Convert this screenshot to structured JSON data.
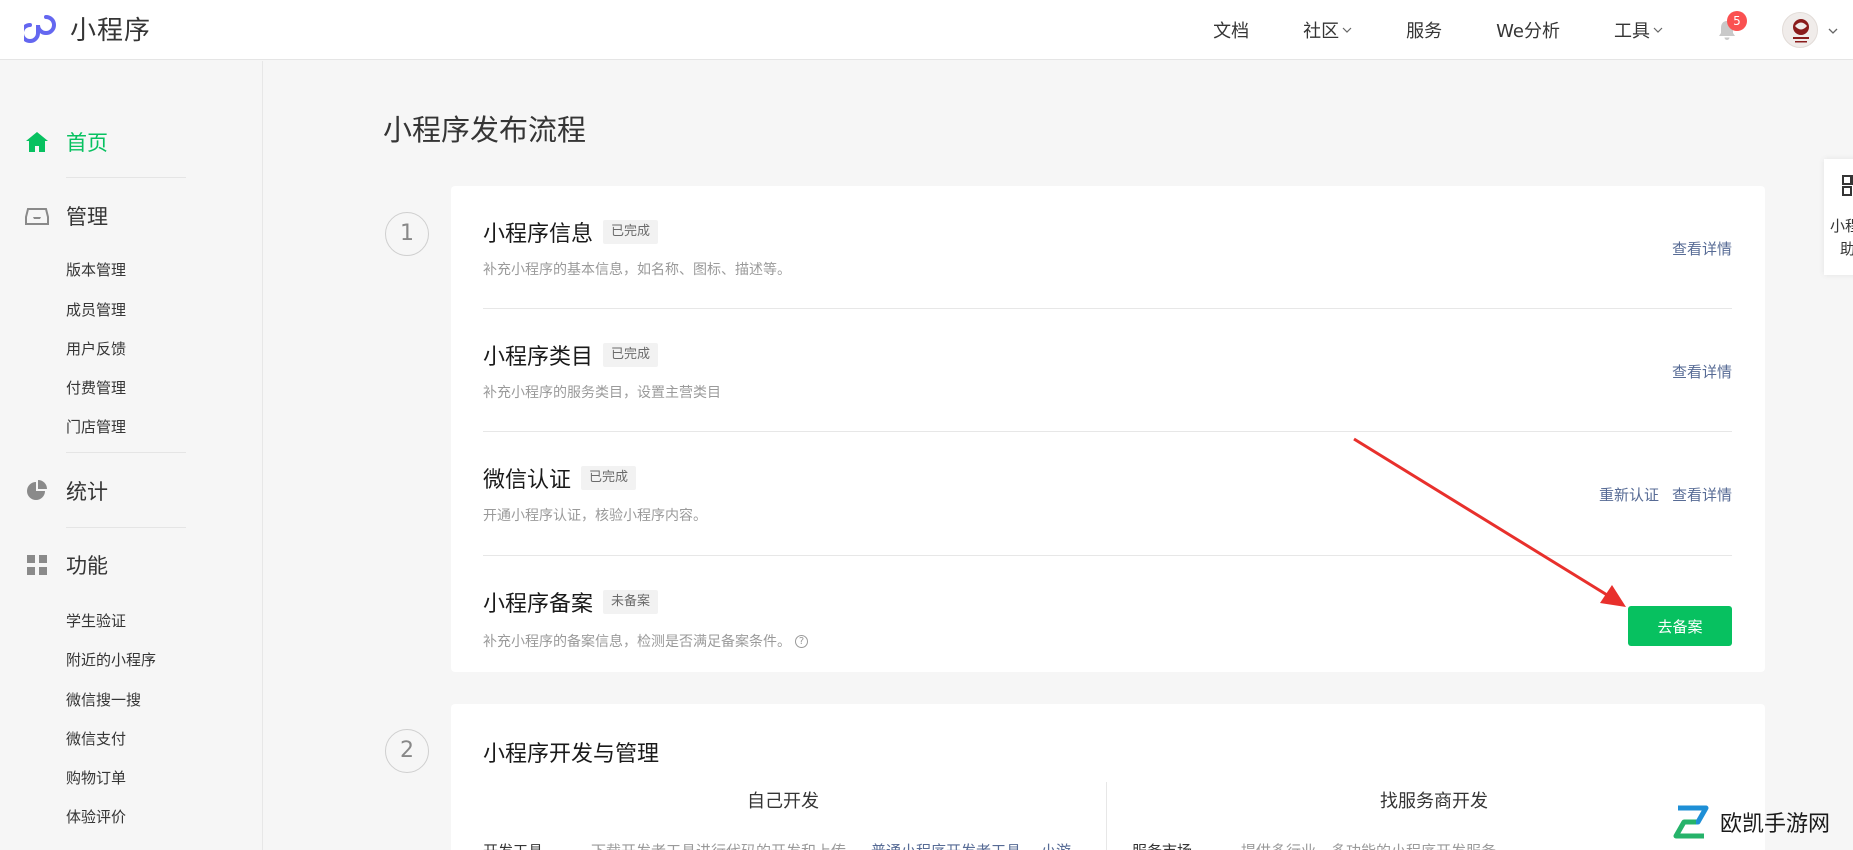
{
  "header": {
    "logo_text": "小程序",
    "nav": [
      {
        "label": "文档",
        "has_dropdown": false
      },
      {
        "label": "社区",
        "has_dropdown": true
      },
      {
        "label": "服务",
        "has_dropdown": false
      },
      {
        "label": "We分析",
        "has_dropdown": false
      },
      {
        "label": "工具",
        "has_dropdown": true
      }
    ],
    "notification_count": "5"
  },
  "sidebar": {
    "home": "首页",
    "manage": "管理",
    "manage_items": [
      "版本管理",
      "成员管理",
      "用户反馈",
      "付费管理",
      "门店管理"
    ],
    "stats": "统计",
    "features": "功能",
    "feature_items": [
      "学生验证",
      "附近的小程序",
      "微信搜一搜",
      "微信支付",
      "购物订单",
      "体验评价"
    ]
  },
  "main": {
    "page_title": "小程序发布流程",
    "step1": {
      "number": "1",
      "rows": [
        {
          "title": "小程序信息",
          "badge": "已完成",
          "desc": "补充小程序的基本信息，如名称、图标、描述等。",
          "links": [
            "查看详情"
          ]
        },
        {
          "title": "小程序类目",
          "badge": "已完成",
          "desc": "补充小程序的服务类目，设置主营类目",
          "links": [
            "查看详情"
          ]
        },
        {
          "title": "微信认证",
          "badge": "已完成",
          "desc": "开通小程序认证，核验小程序内容。",
          "links": [
            "重新认证",
            "查看详情"
          ]
        },
        {
          "title": "小程序备案",
          "badge": "未备案",
          "desc": "补充小程序的备案信息，检测是否满足备案条件。",
          "help": "?",
          "button": "去备案"
        }
      ]
    },
    "step2": {
      "number": "2",
      "title": "小程序开发与管理",
      "col_left": "自己开发",
      "col_right": "找服务商开发",
      "left_label": "开发工具",
      "left_desc": "下载开发者工具进行代码的开发和上传，",
      "left_link1": "普通小程序开发者工具",
      "left_link2": "小游",
      "right_label": "服务市场",
      "right_desc": "提供多行业、多功能的小程序开发服务"
    }
  },
  "float_widget": {
    "line1": "小程",
    "line2": "助"
  },
  "watermark": {
    "text": "欧凯手游网"
  },
  "colors": {
    "accent_green": "#07c160",
    "link_blue": "#576b95",
    "badge_red": "#fa5151",
    "annotation_arrow": "#e8302c"
  }
}
